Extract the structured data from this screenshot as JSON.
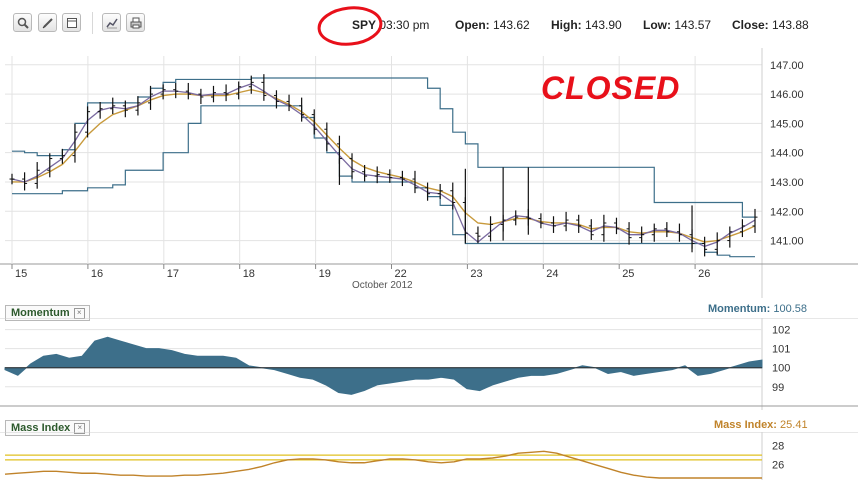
{
  "toolbar": {
    "buttons": [
      {
        "name": "zoom-button",
        "icon": "magnifier-icon"
      },
      {
        "name": "draw-button",
        "icon": "pencil-icon"
      },
      {
        "name": "panel-button",
        "icon": "window-icon"
      },
      {
        "name": "chart-type-button",
        "icon": "line-chart-icon"
      },
      {
        "name": "print-button",
        "icon": "printer-icon"
      }
    ]
  },
  "quote": {
    "symbol": "SPY",
    "time": "03:30 pm",
    "open_label": "Open:",
    "open": "143.62",
    "high_label": "High:",
    "high": "143.90",
    "low_label": "Low:",
    "low": "143.57",
    "close_label": "Close:",
    "close": "143.88"
  },
  "annotation": {
    "text": "CLOSED",
    "color": "#e8101a"
  },
  "colors": {
    "price_bars": "#111111",
    "ma_short": "#7a6aa0",
    "ma_long": "#c89a3c",
    "channel": "#3d6f8a",
    "momentum_fill": "#3d6f8a",
    "mass_line": "#c0832a",
    "mass_levels": "#e0c020",
    "grid": "#e3e3e3"
  },
  "axis": {
    "month_label": "October 2012"
  },
  "chart_data": [
    {
      "type": "ohlc",
      "name": "price",
      "x": [
        "15",
        "16",
        "17",
        "18",
        "19",
        "22",
        "23",
        "24",
        "25",
        "26"
      ],
      "ylim": [
        140.2,
        147.3
      ],
      "yticks": [
        "141.00",
        "142.00",
        "143.00",
        "144.00",
        "145.00",
        "146.00",
        "147.00"
      ],
      "close": [
        143.1,
        142.95,
        143.4,
        143.8,
        143.9,
        144.7,
        145.4,
        145.5,
        145.6,
        145.45,
        145.7,
        146.0,
        146.15,
        146.1,
        146.0,
        145.9,
        146.05,
        146.0,
        146.25,
        146.4,
        145.95,
        145.75,
        145.6,
        145.3,
        144.8,
        144.3,
        143.8,
        143.35,
        143.2,
        143.25,
        143.15,
        143.1,
        142.8,
        142.6,
        142.7,
        142.3,
        141.25,
        141.15,
        141.55,
        141.7,
        141.8,
        141.75,
        141.6,
        141.5,
        141.7,
        141.5,
        141.2,
        141.6,
        141.4,
        141.1,
        141.2,
        141.4,
        141.3,
        141.2,
        140.9,
        140.7,
        141.0,
        141.3,
        141.5,
        141.8
      ],
      "ma_short": [
        143.1,
        143.0,
        143.2,
        143.5,
        143.8,
        144.4,
        145.1,
        145.45,
        145.55,
        145.5,
        145.6,
        145.9,
        146.1,
        146.1,
        146.05,
        145.95,
        146.0,
        146.0,
        146.2,
        146.35,
        146.1,
        145.8,
        145.6,
        145.3,
        144.9,
        144.4,
        143.9,
        143.45,
        143.25,
        143.2,
        143.15,
        143.1,
        142.9,
        142.65,
        142.6,
        142.3,
        141.3,
        140.95,
        141.3,
        141.65,
        141.85,
        141.8,
        141.6,
        141.5,
        141.6,
        141.5,
        141.3,
        141.5,
        141.45,
        141.2,
        141.2,
        141.35,
        141.35,
        141.25,
        141.0,
        140.8,
        140.95,
        141.25,
        141.45,
        141.7
      ],
      "ma_long": [
        143.0,
        143.0,
        143.15,
        143.35,
        143.6,
        144.05,
        144.6,
        145.0,
        145.3,
        145.45,
        145.6,
        145.8,
        145.95,
        146.0,
        146.0,
        145.95,
        145.95,
        145.95,
        146.05,
        146.15,
        146.05,
        145.85,
        145.65,
        145.4,
        145.05,
        144.6,
        144.15,
        143.75,
        143.5,
        143.35,
        143.25,
        143.15,
        143.0,
        142.8,
        142.7,
        142.5,
        141.95,
        141.6,
        141.55,
        141.65,
        141.75,
        141.75,
        141.65,
        141.6,
        141.6,
        141.55,
        141.4,
        141.45,
        141.45,
        141.3,
        141.25,
        141.3,
        141.3,
        141.25,
        141.1,
        140.95,
        141.0,
        141.15,
        141.3,
        141.5
      ],
      "upper": [
        144.05,
        144.0,
        143.9,
        143.9,
        144.1,
        145.0,
        145.7,
        145.7,
        145.7,
        145.7,
        145.9,
        146.2,
        146.4,
        146.5,
        146.5,
        146.5,
        146.5,
        146.5,
        146.5,
        146.55,
        146.55,
        146.55,
        146.55,
        146.55,
        146.55,
        146.55,
        146.55,
        146.55,
        146.55,
        146.55,
        146.55,
        146.55,
        146.55,
        146.2,
        145.5,
        144.7,
        144.3,
        143.5,
        143.5,
        143.5,
        143.5,
        143.5,
        143.5,
        143.5,
        143.5,
        143.5,
        143.5,
        143.5,
        143.5,
        143.5,
        143.5,
        142.3,
        142.3,
        142.3,
        142.3,
        142.3,
        142.3,
        142.3,
        141.8,
        141.8
      ],
      "lower": [
        142.6,
        142.6,
        142.6,
        142.6,
        142.7,
        142.7,
        142.8,
        142.8,
        142.9,
        143.4,
        143.4,
        143.4,
        144.0,
        144.0,
        145.0,
        145.6,
        145.6,
        145.6,
        145.6,
        145.6,
        145.6,
        145.6,
        145.6,
        145.2,
        144.5,
        144.0,
        143.2,
        143.0,
        143.0,
        143.0,
        143.0,
        143.0,
        142.8,
        142.5,
        142.2,
        141.2,
        140.9,
        140.9,
        140.9,
        140.9,
        140.9,
        140.9,
        140.9,
        140.9,
        140.9,
        140.9,
        140.9,
        140.9,
        140.9,
        140.9,
        140.9,
        140.9,
        140.9,
        140.9,
        140.9,
        140.6,
        140.5,
        140.45,
        140.45,
        140.45
      ]
    },
    {
      "type": "area",
      "name": "Momentum",
      "readout_label": "Momentum:",
      "readout_value": "100.58",
      "yticks": [
        "102",
        "101",
        "100",
        "99"
      ],
      "ylim": [
        98.2,
        102.4
      ],
      "baseline": 100,
      "values": [
        99.9,
        99.6,
        100.2,
        100.6,
        100.7,
        100.5,
        100.6,
        101.4,
        101.6,
        101.4,
        101.2,
        101.0,
        101.0,
        100.9,
        100.7,
        100.6,
        100.6,
        100.6,
        100.5,
        100.1,
        100.0,
        99.9,
        99.7,
        99.5,
        99.4,
        99.1,
        98.7,
        98.6,
        98.8,
        99.1,
        99.2,
        99.3,
        99.4,
        99.4,
        99.5,
        99.4,
        98.9,
        98.8,
        99.1,
        99.3,
        99.5,
        99.6,
        99.6,
        99.7,
        99.9,
        100.1,
        100.0,
        99.7,
        99.8,
        99.6,
        99.7,
        99.8,
        99.9,
        100.1,
        99.6,
        99.7,
        99.9,
        100.1,
        100.3,
        100.4
      ],
      "values_note": "one value per bar, aligned with price x"
    },
    {
      "type": "line",
      "name": "Mass Index",
      "readout_label": "Mass Index:",
      "readout_value": "25.41",
      "yticks": [
        "28",
        "26"
      ],
      "ylim": [
        24.6,
        28.8
      ],
      "levels": [
        27.0,
        26.5
      ],
      "values": [
        25.0,
        25.1,
        25.2,
        25.3,
        25.3,
        25.2,
        25.1,
        25.1,
        25.0,
        24.9,
        24.9,
        24.8,
        24.8,
        24.8,
        24.9,
        24.9,
        25.0,
        25.1,
        25.3,
        25.5,
        25.8,
        26.2,
        26.5,
        26.6,
        26.6,
        26.5,
        26.3,
        26.2,
        26.2,
        26.4,
        26.6,
        26.6,
        26.5,
        26.3,
        26.2,
        26.3,
        26.6,
        26.6,
        26.7,
        26.9,
        27.2,
        27.3,
        27.4,
        27.2,
        26.8,
        26.4,
        26.0,
        25.6,
        25.2,
        24.9,
        24.7,
        24.6,
        24.6,
        24.6,
        24.6,
        24.6,
        24.6,
        24.6,
        24.6,
        24.6
      ]
    }
  ]
}
